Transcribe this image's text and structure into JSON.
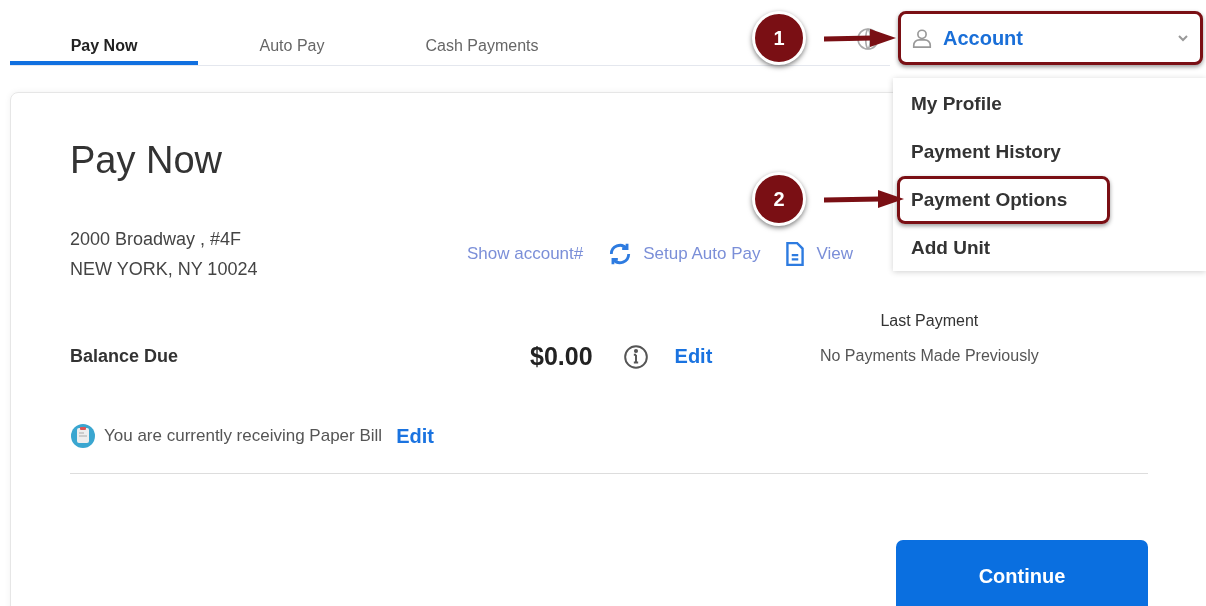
{
  "tabs": [
    {
      "label": "Pay Now",
      "selected": true
    },
    {
      "label": "Auto Pay",
      "selected": false
    },
    {
      "label": "Cash Payments",
      "selected": false
    }
  ],
  "account": {
    "label": "Account",
    "highlighted": true,
    "expanded": true
  },
  "account_menu": [
    {
      "label": "My Profile",
      "highlighted": false
    },
    {
      "label": "Payment History",
      "highlighted": false
    },
    {
      "label": "Payment Options",
      "highlighted": true
    },
    {
      "label": "Add Unit",
      "highlighted": false
    }
  ],
  "callouts": [
    {
      "number": "1"
    },
    {
      "number": "2"
    }
  ],
  "page_title": "Pay Now",
  "address": [
    "2000 Broadway , #4F",
    "NEW YORK, NY 10024"
  ],
  "links": [
    {
      "kind": "text",
      "label": "Show account#"
    },
    {
      "kind": "refresh",
      "label": "Setup Auto Pay"
    },
    {
      "kind": "document",
      "label": "View"
    }
  ],
  "balance": {
    "label": "Balance Due",
    "amount": "$0.00",
    "edit": "Edit"
  },
  "last_payment": {
    "label": "Last Payment",
    "value": "No Payments Made Previously"
  },
  "paper_bill": {
    "text": "You are currently receiving Paper Bill",
    "edit": "Edit"
  },
  "continue_button": "Continue"
}
